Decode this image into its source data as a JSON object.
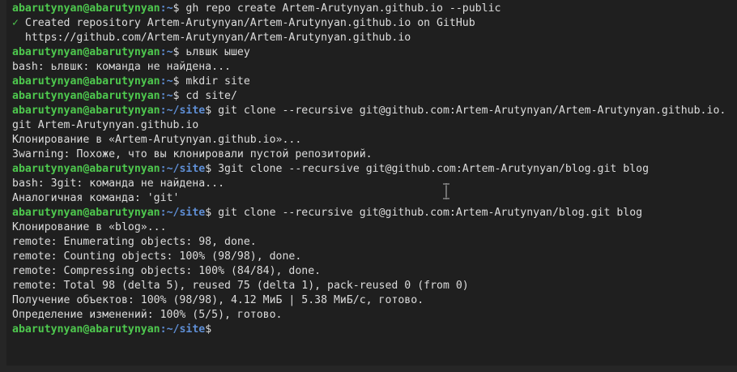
{
  "terminal": {
    "user_host": "abarutynyan@abarutynyan",
    "lines": [
      {
        "type": "prompt",
        "path": ":~",
        "cmd": "gh repo create Artem-Arutynyan.github.io --public"
      },
      {
        "type": "check",
        "mark": "✓",
        "text": " Created repository Artem-Arutynyan/Artem-Arutynyan.github.io on GitHub"
      },
      {
        "type": "out",
        "text": "  https://github.com/Artem-Arutynyan/Artem-Arutynyan.github.io"
      },
      {
        "type": "prompt",
        "path": ":~",
        "cmd": "ьлвшк ышеу"
      },
      {
        "type": "out",
        "text": "bash: ьлвшк: команда не найдена..."
      },
      {
        "type": "prompt",
        "path": ":~",
        "cmd": "mkdir site"
      },
      {
        "type": "prompt",
        "path": ":~",
        "cmd": "cd site/"
      },
      {
        "type": "prompt",
        "path": ":~/site",
        "cmd": "git clone --recursive git@github.com:Artem-Arutynyan/Artem-Arutynyan.github.io."
      },
      {
        "type": "out",
        "text": "git Artem-Arutynyan.github.io"
      },
      {
        "type": "out",
        "text": "Клонирование в «Artem-Arutynyan.github.io»..."
      },
      {
        "type": "out",
        "text": "3warning: Похоже, что вы клонировали пустой репозиторий."
      },
      {
        "type": "prompt",
        "path": ":~/site",
        "cmd": "3git clone --recursive git@github.com:Artem-Arutynyan/blog.git blog"
      },
      {
        "type": "out",
        "text": "bash: 3git: команда не найдена..."
      },
      {
        "type": "out",
        "text": "Аналогичная команда: 'git'"
      },
      {
        "type": "prompt",
        "path": ":~/site",
        "cmd": "git clone --recursive git@github.com:Artem-Arutynyan/blog.git blog"
      },
      {
        "type": "out",
        "text": "Клонирование в «blog»..."
      },
      {
        "type": "out",
        "text": "remote: Enumerating objects: 98, done."
      },
      {
        "type": "out",
        "text": "remote: Counting objects: 100% (98/98), done."
      },
      {
        "type": "out",
        "text": "remote: Compressing objects: 100% (84/84), done."
      },
      {
        "type": "out",
        "text": "remote: Total 98 (delta 5), reused 75 (delta 1), pack-reused 0 (from 0)"
      },
      {
        "type": "out",
        "text": "Получение объектов: 100% (98/98), 4.12 МиБ | 5.38 МиБ/с, готово."
      },
      {
        "type": "out",
        "text": "Определение изменений: 100% (5/5), готово."
      },
      {
        "type": "prompt",
        "path": ":~/site",
        "cmd": ""
      }
    ]
  },
  "colors": {
    "background": "#1f1f1f",
    "user": "#4ec94e",
    "path": "#5f8fd6",
    "text": "#dcdcdc"
  },
  "icons": {
    "mouse_cursor": "text-ibeam-cursor-icon"
  }
}
